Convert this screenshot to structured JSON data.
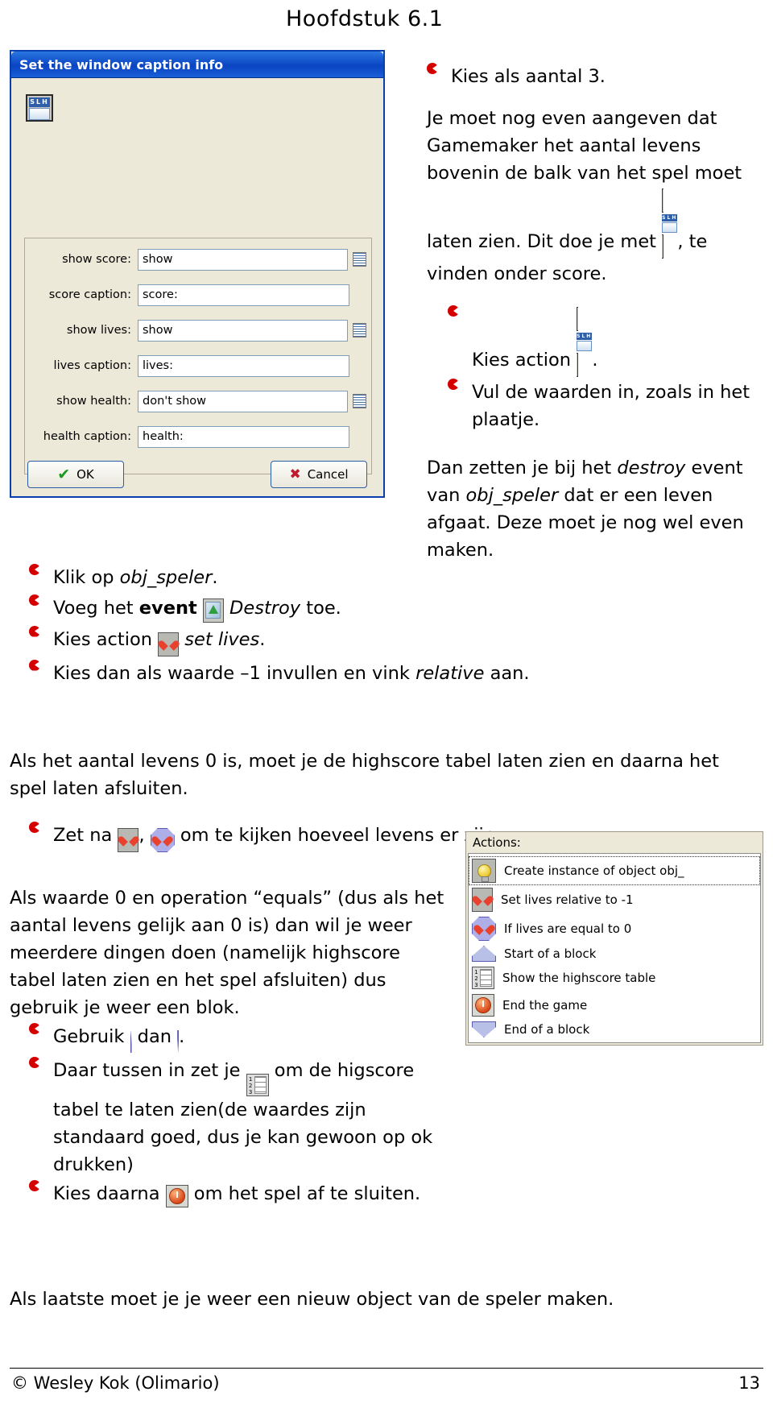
{
  "header": {
    "chapter": "Hoofdstuk 6.1"
  },
  "dialog": {
    "title": "Set the window caption info",
    "icon_label": "SLH",
    "fields": [
      {
        "label": "show score:",
        "value": "show",
        "has_menu_icon": true
      },
      {
        "label": "score caption:",
        "value": "score:",
        "has_menu_icon": false
      },
      {
        "label": "show lives:",
        "value": "show",
        "has_menu_icon": true
      },
      {
        "label": "lives caption:",
        "value": "lives:",
        "has_menu_icon": false
      },
      {
        "label": "show health:",
        "value": "don't show",
        "has_menu_icon": true
      },
      {
        "label": "health caption:",
        "value": "health:",
        "has_menu_icon": false
      }
    ],
    "ok_label": "OK",
    "cancel_label": "Cancel"
  },
  "right_column": {
    "bullet1": "Kies als aantal 3.",
    "para1_a": "Je moet nog even aangeven dat Gamemaker het aantal levens bovenin de balk van het spel moet laten zien. Dit doe je met",
    "para1_b": ", te vinden onder score.",
    "bullet2_a": "Kies action",
    "bullet2_b": ".",
    "bullet3": "Vul de waarden in, zoals in het plaatje.",
    "para2_a": "Dan zetten je bij het ",
    "para2_destroy": "destroy",
    "para2_b": " event van ",
    "para2_obj": "obj_speler",
    "para2_c": " dat er een leven afgaat. Deze moet je nog wel even maken."
  },
  "mid_bullets": {
    "b1_a": "Klik op ",
    "b1_obj": "obj_speler",
    "b1_b": ".",
    "b2_a": "Voeg het ",
    "b2_event": "event",
    "b2_b": " ",
    "b2_destroy": "Destroy",
    "b2_c": " toe.",
    "b3_a": "Kies action",
    "b3_setlives": "set lives",
    "b3_b": ".",
    "b4_a": "Kies dan als waarde –1 invullen en vink ",
    "b4_relative": "relative",
    "b4_b": " aan."
  },
  "para3": "Als het aantal levens 0 is, moet je de highscore tabel laten zien en daarna het spel laten afsluiten.",
  "zet_na": {
    "a": "Zet na",
    "b": ",",
    "c": "om te kijken hoeveel levens er zijn."
  },
  "lower_left": {
    "para_a": "Als waarde 0 en operation “equals” (dus als het aantal levens gelijk aan 0 is) dan wil je weer meerdere dingen doen (namelijk highscore tabel laten zien en het spel afsluiten) dus gebruik je weer een blok.",
    "b_gebruik_a": "Gebruik",
    "b_gebruik_b": "dan",
    "b_gebruik_c": ".",
    "b_daar_a": "Daar tussen in zet je",
    "b_daar_b": "om de higscore tabel te laten zien(de waardes zijn standaard goed, dus je kan gewoon op ok drukken)",
    "b_kies_a": "Kies  daarna",
    "b_kies_b": "om het spel af te sluiten."
  },
  "para4": "Als laatste moet je je weer een nieuw object van de speler maken.",
  "actions_panel": {
    "header": "Actions:",
    "items": [
      {
        "label": "Create instance of object obj_",
        "icon": "bulb-icon",
        "selected": true
      },
      {
        "label": "Set lives relative to -1",
        "icon": "heart-square-icon",
        "selected": false
      },
      {
        "label": "If lives are equal to 0",
        "icon": "heart-octagon-icon",
        "selected": false
      },
      {
        "label": "Start of a block",
        "icon": "block-start-icon",
        "selected": false
      },
      {
        "label": "Show the highscore table",
        "icon": "highscore-icon",
        "selected": false
      },
      {
        "label": "End the game",
        "icon": "end-game-icon",
        "selected": false
      },
      {
        "label": "End of a block",
        "icon": "block-end-icon",
        "selected": false
      }
    ]
  },
  "footer": {
    "copyright": "© Wesley Kok (Olimario)",
    "page": "13"
  }
}
